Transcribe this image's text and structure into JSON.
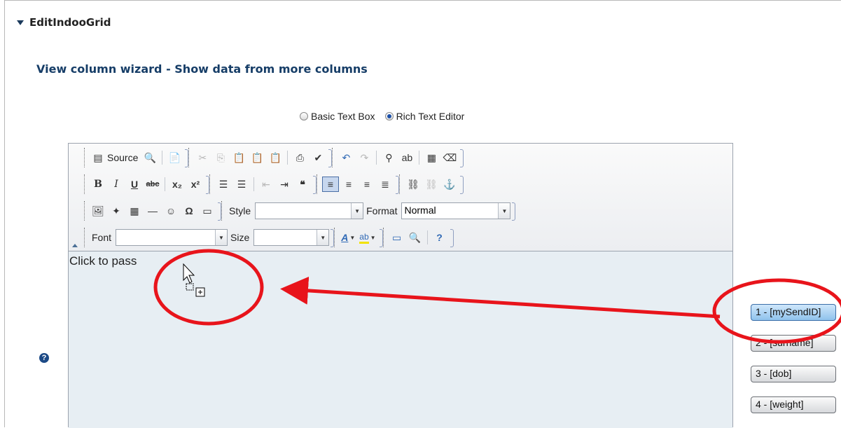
{
  "section": {
    "title": "EditIndooGrid"
  },
  "wizard": {
    "title": "View column wizard - Show data from more columns"
  },
  "mode": {
    "options": [
      {
        "label": "Basic Text Box",
        "selected": false
      },
      {
        "label": "Rich Text Editor",
        "selected": true
      }
    ]
  },
  "toolbar": {
    "source_label": "Source",
    "style_label": "Style",
    "style_value": "",
    "format_label": "Format",
    "format_value": "Normal",
    "font_label": "Font",
    "font_value": "",
    "size_label": "Size",
    "size_value": "",
    "icons": {
      "row1": [
        "source-icon",
        "preview-icon",
        "templates-icon",
        "cut-icon",
        "copy-icon",
        "paste-icon",
        "paste-text-icon",
        "paste-word-icon",
        "print-icon",
        "spellcheck-icon",
        "undo-icon",
        "redo-icon",
        "find-icon",
        "replace-icon",
        "select-all-icon",
        "remove-format-icon"
      ],
      "row2": [
        "bold-icon",
        "italic-icon",
        "underline-icon",
        "strike-icon",
        "subscript-icon",
        "superscript-icon",
        "numbered-list-icon",
        "bulleted-list-icon",
        "outdent-icon",
        "indent-icon",
        "blockquote-icon",
        "align-left-icon",
        "align-center-icon",
        "align-right-icon",
        "justify-icon",
        "link-icon",
        "unlink-icon",
        "anchor-icon"
      ],
      "row3": [
        "image-icon",
        "flash-icon",
        "table-icon",
        "horizontal-rule-icon",
        "smiley-icon",
        "special-char-icon",
        "page-break-icon"
      ],
      "row4": [
        "text-color-icon",
        "bg-color-icon",
        "maximize-icon",
        "show-blocks-icon",
        "about-icon"
      ]
    }
  },
  "editor": {
    "content": "Click to pass"
  },
  "columns": [
    {
      "label": "1 - [mySendID]",
      "selected": true
    },
    {
      "label": "2 - [surname]",
      "selected": false
    },
    {
      "label": "3 - [dob]",
      "selected": false
    },
    {
      "label": "4 - [weight]",
      "selected": false
    }
  ],
  "colors": {
    "accent": "#163d67",
    "annotation": "#e8141b",
    "editor_bg": "#e7eef3"
  }
}
